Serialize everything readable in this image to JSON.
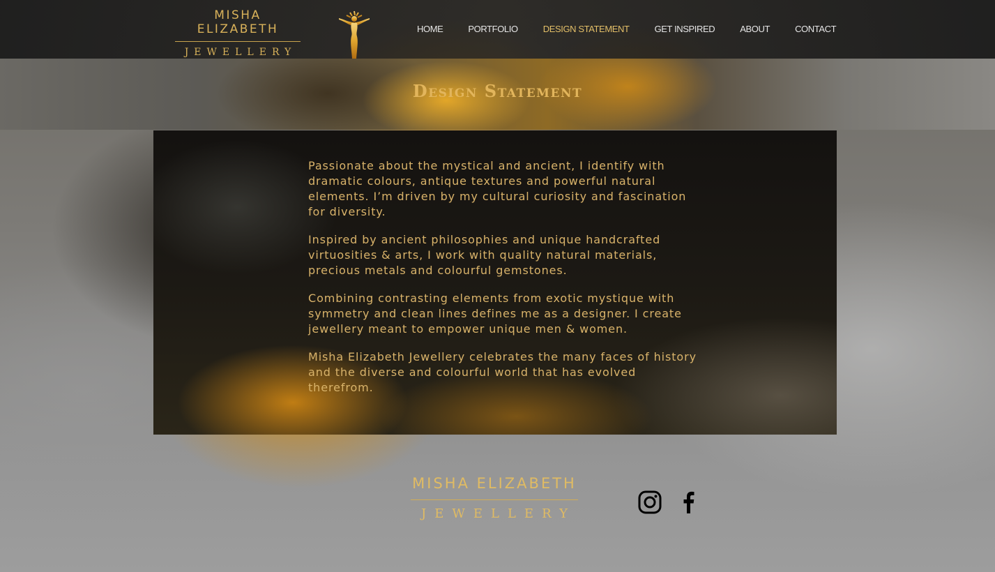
{
  "brand": {
    "name_top": "MISHA ELIZABETH",
    "name_bottom": "JEWELLERY"
  },
  "nav": {
    "items": [
      {
        "label": "HOME"
      },
      {
        "label": "PORTFOLIO"
      },
      {
        "label": "DESIGN STATEMENT"
      },
      {
        "label": "GET INSPIRED"
      },
      {
        "label": "ABOUT"
      },
      {
        "label": "CONTACT"
      }
    ],
    "active": "DESIGN STATEMENT"
  },
  "page": {
    "title": "Design Statement"
  },
  "statement": {
    "paragraphs": [
      "Passionate about the mystical and ancient, I identify with dramatic colours, antique textures and powerful natural elements. I’m driven by my cultural curiosity and fascination for diversity.",
      "Inspired by ancient philosophies and unique handcrafted virtuosities & arts, I work with quality natural materials, precious metals and colourful gemstones.",
      "Combining contrasting elements from exotic mystique with symmetry and clean lines defines me as a designer. I create jewellery meant to empower unique men & women.",
      "Misha Elizabeth Jewellery celebrates the many faces of history and the diverse and colourful world that has evolved therefrom."
    ]
  },
  "footer": {
    "name_top": "MISHA ELIZABETH",
    "name_bottom": "JEWELLERY",
    "social": [
      {
        "icon": "instagram-icon"
      },
      {
        "icon": "facebook-icon"
      }
    ]
  },
  "colors": {
    "accent_gold": "#d9b25a",
    "nav_text": "#e6e6e6",
    "header_bg": "#1c1c1c"
  }
}
